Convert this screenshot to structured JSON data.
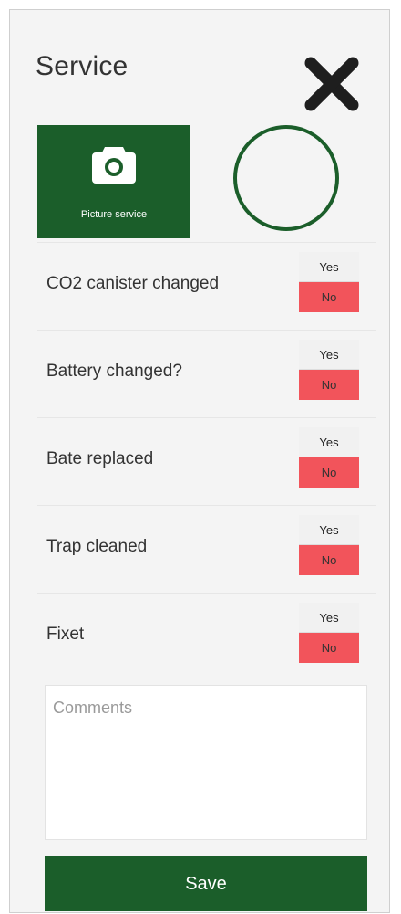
{
  "header": {
    "title": "Service"
  },
  "photo": {
    "button_label": "Picture service"
  },
  "checklist": [
    {
      "label": "CO2 canister changed",
      "yes_label": "Yes",
      "no_label": "No"
    },
    {
      "label": "Battery changed?",
      "yes_label": "Yes",
      "no_label": "No"
    },
    {
      "label": "Bate replaced",
      "yes_label": "Yes",
      "no_label": "No"
    },
    {
      "label": "Trap cleaned",
      "yes_label": "Yes",
      "no_label": "No"
    },
    {
      "label": "Fixet",
      "yes_label": "Yes",
      "no_label": "No"
    }
  ],
  "comments": {
    "placeholder": "Comments",
    "value": ""
  },
  "save_label": "Save",
  "colors": {
    "primary": "#1b5e2a",
    "no_selected": "#f2545b",
    "background": "#f4f4f4"
  },
  "icons": {
    "close": "close-x-icon",
    "camera": "camera-icon"
  }
}
